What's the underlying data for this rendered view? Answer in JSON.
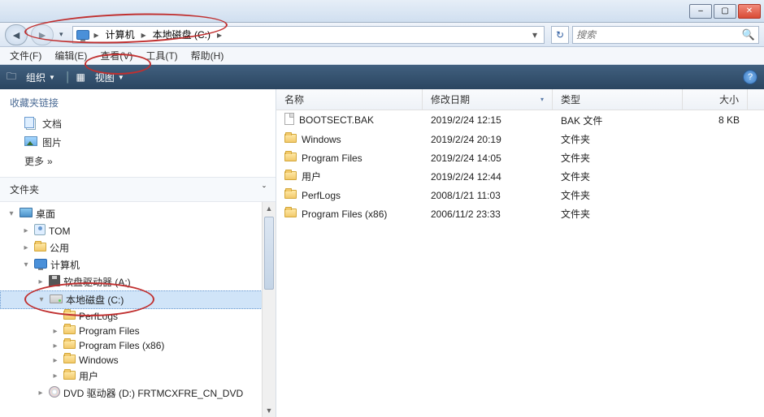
{
  "window": {
    "min": "–",
    "max": "▢",
    "close": "✕"
  },
  "nav": {
    "back": "◄",
    "fwd": "►",
    "seg1": "计算机",
    "seg2": "本地磁盘 (C:)",
    "refresh": "↻",
    "search_placeholder": "搜索"
  },
  "menu": {
    "file": "文件(F)",
    "edit": "编辑(E)",
    "view": "查看(V)",
    "tools": "工具(T)",
    "help": "帮助(H)"
  },
  "toolbar": {
    "organize": "组织",
    "views": "视图",
    "help": "?"
  },
  "fav": {
    "header": "收藏夹链接",
    "docs": "文档",
    "pics": "图片",
    "more": "更多",
    "chev": "»"
  },
  "tree": {
    "header": "文件夹",
    "collapse": "ˇ",
    "items": [
      {
        "indent": 0,
        "exp": "▾",
        "icon": "desktop",
        "label": "桌面"
      },
      {
        "indent": 1,
        "exp": "▸",
        "icon": "user",
        "label": "TOM"
      },
      {
        "indent": 1,
        "exp": "▸",
        "icon": "folder",
        "label": "公用"
      },
      {
        "indent": 1,
        "exp": "▾",
        "icon": "monitor",
        "label": "计算机"
      },
      {
        "indent": 2,
        "exp": "▸",
        "icon": "floppy",
        "label": "软盘驱动器 (A:)"
      },
      {
        "indent": 2,
        "exp": "▾",
        "icon": "drive",
        "label": "本地磁盘 (C:)",
        "selected": true
      },
      {
        "indent": 3,
        "exp": "",
        "icon": "folder",
        "label": "PerfLogs"
      },
      {
        "indent": 3,
        "exp": "▸",
        "icon": "folder",
        "label": "Program Files"
      },
      {
        "indent": 3,
        "exp": "▸",
        "icon": "folder",
        "label": "Program Files (x86)"
      },
      {
        "indent": 3,
        "exp": "▸",
        "icon": "folder",
        "label": "Windows"
      },
      {
        "indent": 3,
        "exp": "▸",
        "icon": "folder",
        "label": "用户"
      },
      {
        "indent": 2,
        "exp": "▸",
        "icon": "cd",
        "label": "DVD 驱动器 (D:) FRTMCXFRE_CN_DVD"
      }
    ]
  },
  "columns": {
    "name": "名称",
    "date": "修改日期",
    "type": "类型",
    "size": "大小"
  },
  "rows": [
    {
      "icon": "doc",
      "name": "BOOTSECT.BAK",
      "date": "2019/2/24 12:15",
      "type": "BAK 文件",
      "size": "8 KB"
    },
    {
      "icon": "folder",
      "name": "Windows",
      "date": "2019/2/24 20:19",
      "type": "文件夹",
      "size": ""
    },
    {
      "icon": "folder",
      "name": "Program Files",
      "date": "2019/2/24 14:05",
      "type": "文件夹",
      "size": ""
    },
    {
      "icon": "folder",
      "name": "用户",
      "date": "2019/2/24 12:44",
      "type": "文件夹",
      "size": ""
    },
    {
      "icon": "folder",
      "name": "PerfLogs",
      "date": "2008/1/21 11:03",
      "type": "文件夹",
      "size": ""
    },
    {
      "icon": "folder",
      "name": "Program Files (x86)",
      "date": "2006/11/2 23:33",
      "type": "文件夹",
      "size": ""
    }
  ]
}
